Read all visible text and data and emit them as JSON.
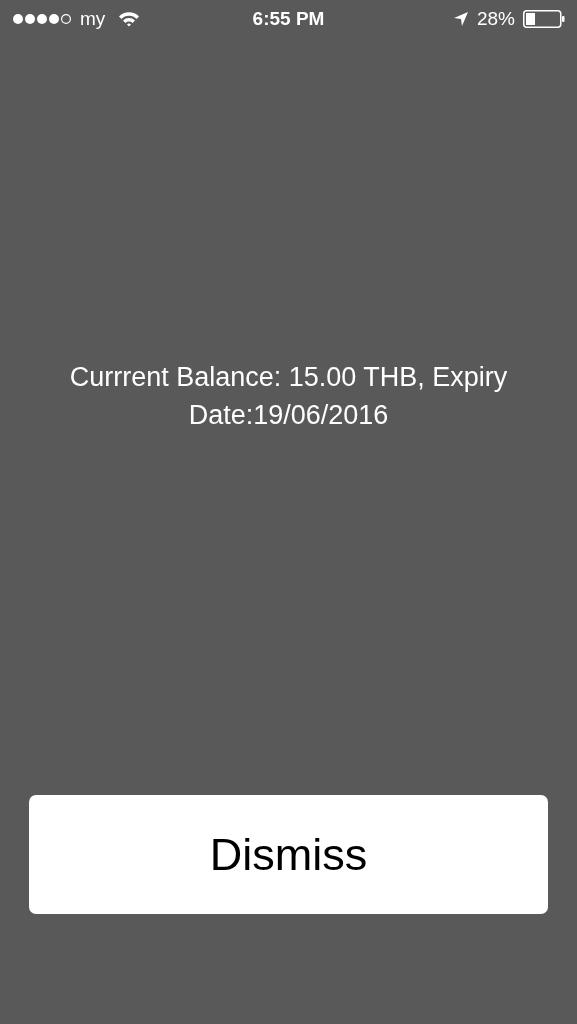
{
  "status_bar": {
    "carrier": "my",
    "time": "6:55 PM",
    "battery": "28%"
  },
  "message": "Currrent Balance: 15.00 THB, Expiry Date:19/06/2016",
  "buttons": [
    "Dismiss"
  ]
}
